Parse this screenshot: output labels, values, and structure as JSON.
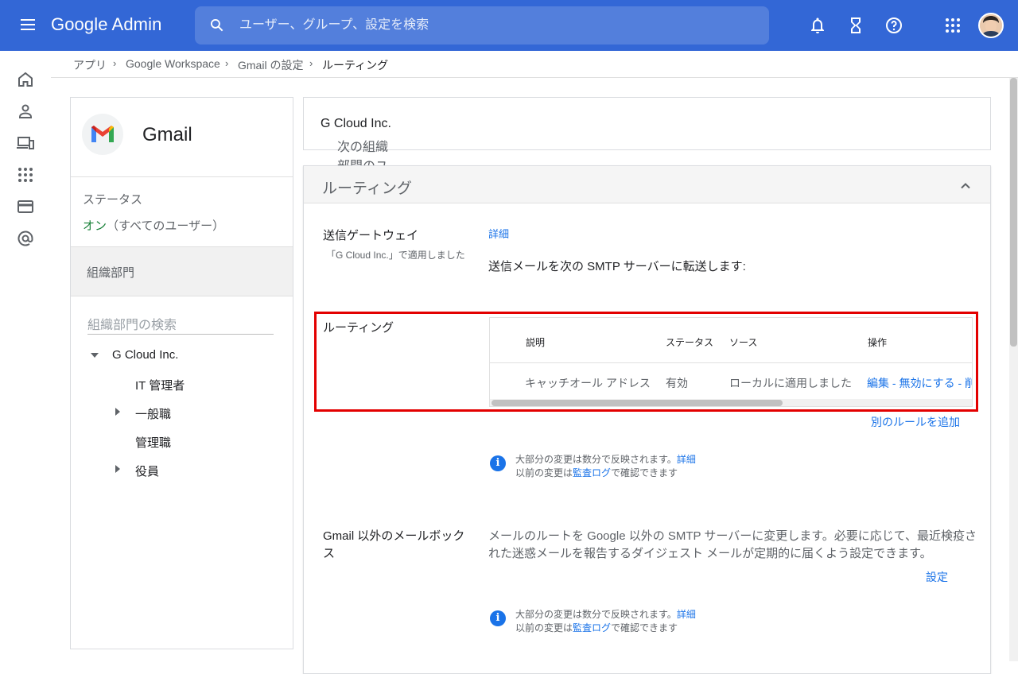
{
  "header": {
    "logo": "Google Admin",
    "search_placeholder": "ユーザー、グループ、設定を検索",
    "icons": [
      "menu-icon",
      "search-icon",
      "bell-icon",
      "hourglass-icon",
      "help-icon",
      "apps-grid-icon",
      "avatar"
    ]
  },
  "leftnav": {
    "icons": [
      "home-icon",
      "person-icon",
      "devices-icon",
      "apps-icon",
      "billing-icon",
      "at-icon"
    ]
  },
  "breadcrumb": {
    "items": [
      "アプリ",
      "Google Workspace",
      "Gmail の設定",
      "ルーティング"
    ]
  },
  "app_panel": {
    "name": "Gmail",
    "status_label": "ステータス",
    "status_on": "オン",
    "status_scope": "（すべてのユーザー）",
    "orgunit_label": "組織部門",
    "org_search_placeholder": "組織部門の検索",
    "tree": {
      "root": "G Cloud Inc.",
      "children": [
        "IT 管理者",
        "一般職",
        "管理職",
        "役員"
      ]
    }
  },
  "notice": {
    "prefix": "次の組織部門のユーザー設定を表示しています: ",
    "org": "G Cloud Inc."
  },
  "section": {
    "title": "ルーティング",
    "outbound": {
      "label": "送信ゲートウェイ",
      "applied": "「G Cloud Inc.」で適用しました",
      "detail_link": "詳細",
      "description": "送信メールを次の SMTP サーバーに転送します:"
    },
    "routing": {
      "label": "ルーティング",
      "columns": [
        "説明",
        "ステータス",
        "ソース",
        "操作"
      ],
      "rows": [
        {
          "description": "キャッチオール アドレス",
          "status": "有効",
          "source": "ローカルに適用しました",
          "actions": "編集 - 無効にする - 削除"
        }
      ],
      "add_rule": "別のルールを追加"
    },
    "info1": {
      "line1_text": "大部分の変更は数分で反映されます。",
      "line1_link": "詳細",
      "line2_prefix": "以前の変更は",
      "line2_link": "監査ログ",
      "line2_suffix": "で確認できます"
    },
    "non_gmail": {
      "label_line1": "Gmail 以外のメールボック",
      "label_line2": "ス",
      "desc_line1": "メールのルートを Google 以外の SMTP サーバーに変更します。必要に応じて、最近検疫さ",
      "desc_line2": "れた迷惑メールを報告するダイジェスト メールが定期的に届くよう設定できます。",
      "settings_link": "設定"
    },
    "info2": {
      "line1_text": "大部分の変更は数分で反映されます。",
      "line1_link": "詳細",
      "line2_prefix": "以前の変更は",
      "line2_link": "監査ログ",
      "line2_suffix": "で確認できます"
    }
  },
  "colors": {
    "header_bg": "#3367d6",
    "link": "#1a73e8",
    "status_on": "#188038",
    "highlight": "#e30000"
  }
}
